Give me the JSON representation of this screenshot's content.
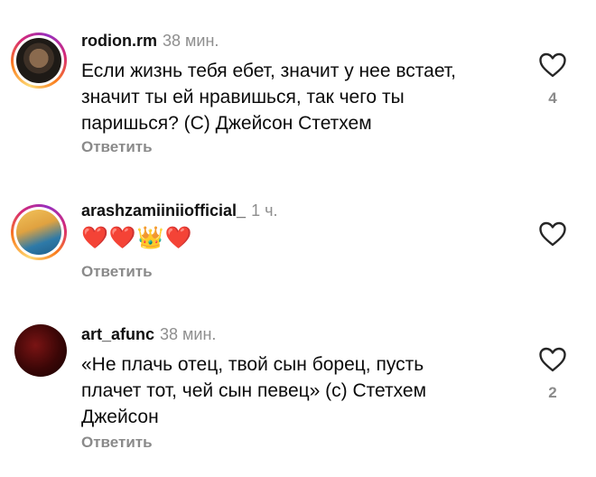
{
  "comments": [
    {
      "username": "rodion.rm",
      "time": "38 мин.",
      "lines": [
        "Если жизнь тебя ебет, значит у нее встает,",
        "значит ты ей нравишься, так чего ты",
        "паришься? (С) Джейсон Стетхем"
      ],
      "reply_label": "Ответить",
      "likes": "4"
    },
    {
      "username": "arashzamiiniiofficial_",
      "time": "1 ч.",
      "emojis": "❤️❤️👑❤️",
      "reply_label": "Ответить",
      "likes": ""
    },
    {
      "username": "art_afunc",
      "time": "38 мин.",
      "lines": [
        "«Не плачь отец, твой сын борец, пусть",
        "плачет тот, чей сын певец» (с) Стетхем",
        "Джейсон"
      ],
      "reply_label": "Ответить",
      "likes": "2"
    }
  ],
  "icons": {
    "avatar_ring": "instagram-story-ring",
    "like": "heart-outline-icon"
  },
  "colors": {
    "secondary_text": "#8a8a8a",
    "primary_text": "#0b0b0b",
    "background": "#ffffff"
  }
}
